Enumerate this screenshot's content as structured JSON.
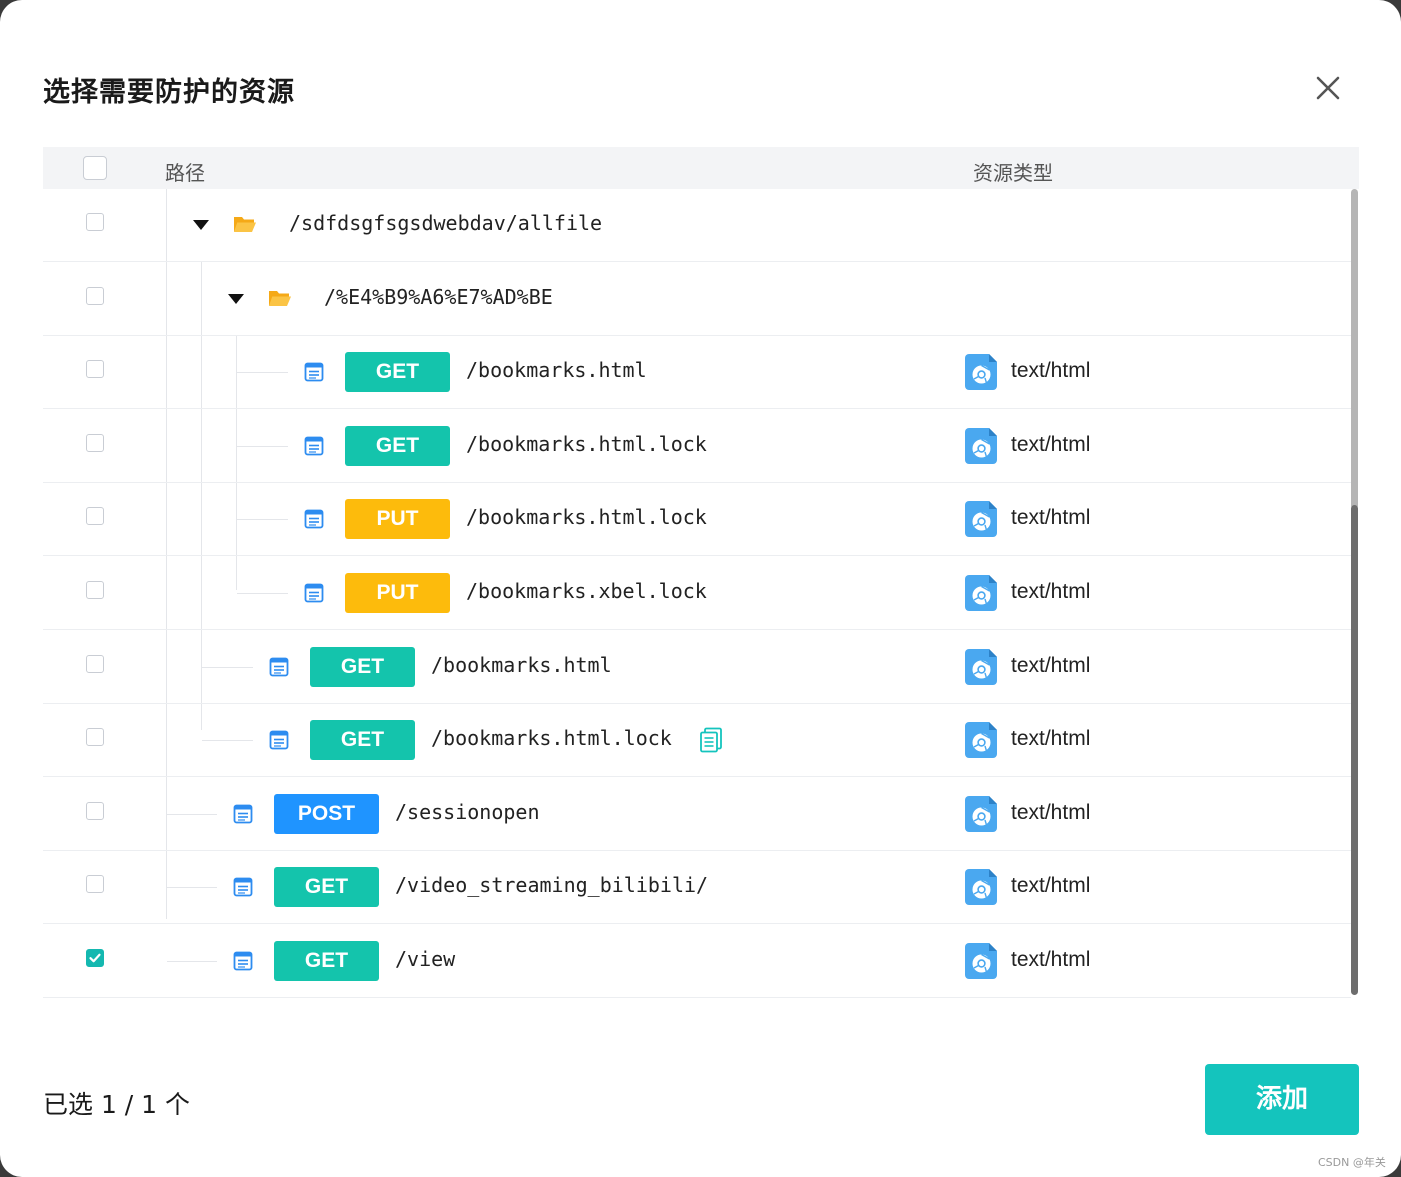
{
  "dialog": {
    "title": "选择需要防护的资源",
    "close_icon": "close-icon"
  },
  "table": {
    "headers": {
      "path": "路径",
      "type": "资源类型"
    },
    "rows": [
      {
        "kind": "folder",
        "path": "/sdfdsgfsgsdwebdav/allfile",
        "type": "",
        "checked": false,
        "depth": 1
      },
      {
        "kind": "folder",
        "path": "/%E4%B9%A6%E7%AD%BE",
        "type": "",
        "checked": false,
        "depth": 2
      },
      {
        "kind": "file",
        "method": "GET",
        "path": "/bookmarks.html",
        "type": "text/html",
        "checked": false,
        "depth": 3
      },
      {
        "kind": "file",
        "method": "GET",
        "path": "/bookmarks.html.lock",
        "type": "text/html",
        "checked": false,
        "depth": 3
      },
      {
        "kind": "file",
        "method": "PUT",
        "path": "/bookmarks.html.lock",
        "type": "text/html",
        "checked": false,
        "depth": 3
      },
      {
        "kind": "file",
        "method": "PUT",
        "path": "/bookmarks.xbel.lock",
        "type": "text/html",
        "checked": false,
        "depth": 3
      },
      {
        "kind": "file",
        "method": "GET",
        "path": "/bookmarks.html",
        "type": "text/html",
        "checked": false,
        "depth": 2
      },
      {
        "kind": "file",
        "method": "GET",
        "path": "/bookmarks.html.lock",
        "type": "text/html",
        "checked": false,
        "depth": 2,
        "copy_icon": true
      },
      {
        "kind": "file",
        "method": "POST",
        "path": "/sessionopen",
        "type": "text/html",
        "checked": false,
        "depth": 1
      },
      {
        "kind": "file",
        "method": "GET",
        "path": "/video_streaming_bilibili/",
        "type": "text/html",
        "checked": false,
        "depth": 1
      },
      {
        "kind": "file",
        "method": "GET",
        "path": "/view",
        "type": "text/html",
        "checked": true,
        "depth": 1
      }
    ]
  },
  "colors": {
    "GET": "#14c4ac",
    "PUT": "#fdbb0c",
    "POST": "#1f94ff",
    "accent": "#14c4bd"
  },
  "footer": {
    "selected_text": "已选 1 / 1 个",
    "add_label": "添加"
  },
  "watermark": "CSDN @年关"
}
